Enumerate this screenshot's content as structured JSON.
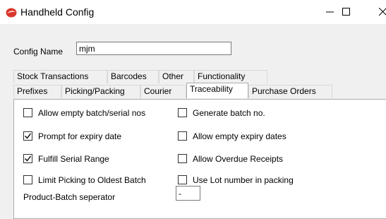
{
  "window": {
    "title": "Handheld Config",
    "icon": "red-logo-icon"
  },
  "titlebar_buttons": {
    "minimize": "minimize-icon",
    "maximize": "maximize-icon",
    "close": "close-icon"
  },
  "config": {
    "label": "Config Name",
    "value": "mjm"
  },
  "tabs_row1": [
    "Stock Transactions",
    "Barcodes",
    "Other",
    "Functionality"
  ],
  "tabs_row2": [
    "Prefixes",
    "Picking/Packing",
    "Courier",
    "Traceability",
    "Purchase Orders"
  ],
  "active_tab": "Traceability",
  "left_options": [
    {
      "label": "Allow empty batch/serial nos",
      "checked": false
    },
    {
      "label": "Prompt for expiry date",
      "checked": true
    },
    {
      "label": "Fulfill Serial Range",
      "checked": true
    },
    {
      "label": "Limit Picking to Oldest Batch",
      "checked": false
    }
  ],
  "right_options": [
    {
      "label": "Generate batch no.",
      "checked": false
    },
    {
      "label": "Allow empty expiry dates",
      "checked": false
    },
    {
      "label": "Allow Overdue Receipts",
      "checked": false
    },
    {
      "label": "Use Lot number in packing",
      "checked": false
    }
  ],
  "separator": {
    "label": "Product-Batch seperator",
    "value": "-"
  },
  "colors": {
    "accent": "#d9362b",
    "panel": "#ffffff",
    "background": "#f0f0f0"
  }
}
